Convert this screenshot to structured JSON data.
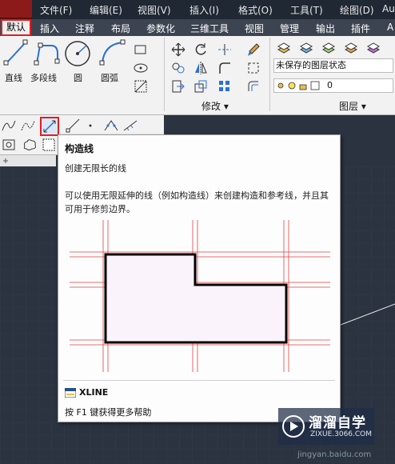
{
  "menubar": {
    "items": [
      "文件(F)",
      "编辑(E)",
      "视图(V)",
      "插入(I)",
      "格式(O)",
      "工具(T)",
      "绘图(D)",
      "Au"
    ]
  },
  "ribbon_tabs": [
    "默认",
    "插入",
    "注释",
    "布局",
    "参数化",
    "三维工具",
    "视图",
    "管理",
    "输出",
    "插件",
    "A"
  ],
  "active_tab": "默认",
  "draw_panel": {
    "tools": [
      "直线",
      "多段线",
      "圆",
      "圆弧"
    ]
  },
  "modify_panel": {
    "title": "修改 ▾"
  },
  "layers_panel": {
    "state_label": "未保存的图层状态",
    "current_layer": "0",
    "title": "图层 ▾"
  },
  "tooltip": {
    "title": "构造线",
    "subtitle": "创建无限长的线",
    "body": "可以使用无限延伸的线（例如构造线）来创建构造和参考线，并且其可用于修剪边界。",
    "command": "XLINE",
    "help": "按 F1 键获得更多帮助"
  },
  "watermark": {
    "name": "溜溜自学",
    "url": "ZIXUE.3066.COM"
  },
  "bottom_url": "jingyan.baidu.com",
  "colors": {
    "highlight_red": "#e02020",
    "canvas": "#2b3340",
    "ribbon": "#f2f2f2",
    "construction_line": "#e04040"
  }
}
